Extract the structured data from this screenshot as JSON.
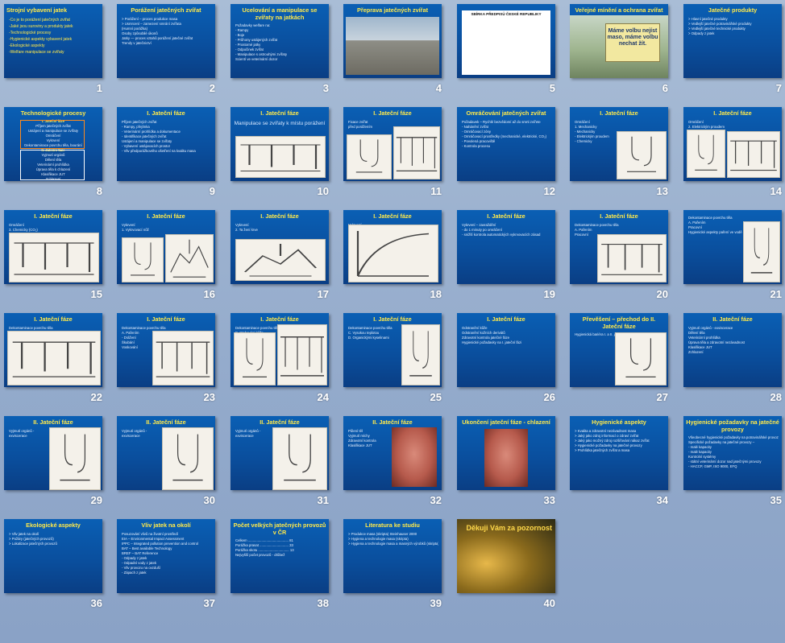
{
  "window": {
    "view": "slide-sorter"
  },
  "slides": [
    {
      "n": "1",
      "title": "Strojní vybavení jatek",
      "lines": [
        "-Co je to porážení jatečných zvířat",
        "-Jaké jsou suroviny a produkty jatek",
        "-Technologické procesy",
        "-Hygienické aspekty vybavení jatek",
        "-Ekologické aspekty",
        "-Welfare manipulace se zvířaty"
      ]
    },
    {
      "n": "2",
      "title": "Porážení jatečných  zvířat",
      "lines": [
        "> Porážení – proces produkce masa",
        "> Usmrcení – zamezení smrání zvířata",
        "(Humní porážka)",
        "",
        "Osoby způsobilé  úkonů",
        "Jatky — proces vztahů porážení jatečné zvířat",
        "Trendy v jatečnictví"
      ]
    },
    {
      "n": "3",
      "title": "Ucelování a manipulace se zvířaty na jatkách",
      "lines": [
        "Požadavky welfare na:",
        "- Rampy",
        "- Boje",
        "- Průhony ustájených zvířat",
        "- Prostorné jatky",
        "- Odpočinek zvířat",
        "- Manipulace s ostrouhými zvířaty",
        "",
        "Scientí ve veterinární dozor"
      ]
    },
    {
      "n": "4",
      "title": "Přeprava jatečných  zvířat",
      "lines": [
        "Požadavky welfare a"
      ]
    },
    {
      "n": "5",
      "title": "SBÍRKA PŘEDPISŮ ČESKÉ REPUBLIKY",
      "lines": []
    },
    {
      "n": "6",
      "title": "Veřejné mínění a ochrana zvířat",
      "lines": [],
      "billboard": "Máme volbu nejíst maso, máme volbu nechat žít."
    },
    {
      "n": "7",
      "title": "Jatečné produkty",
      "lines": [
        "> Hlavní jatečné produkty",
        "> Vedlejší jatečné potravinářské produkty",
        "> Vedlejší jatečné technické produkty",
        "> Odpady z jatek"
      ]
    },
    {
      "n": "8",
      "title": "Technologické  procesy",
      "lines": [
        "I. Jateční fáze",
        "Příjem jatečných zvířat",
        "Ustájení a manipulace se zvířaty",
        "Omráčení",
        "Vykrvení",
        "Dekontaminace povrchu těla, bourání",
        "II. Jateční fáze",
        "Vyjmutí orgánů",
        "Dělení těla",
        "Veterinární prohlídka",
        "Úprava těla k chlazení",
        "Klasifikace JUT",
        "Zchlazení"
      ]
    },
    {
      "n": "9",
      "title": "I. Jateční fáze",
      "lines": [
        "Příjem jatečných zvířat",
        "- Rampy, přejímka",
        "- Veterinární prohlídka a dokumentace",
        "- Identifikace jatečných zvířat",
        "Ustájení a manipulace se zvířaty",
        "- Vybavení ustájovacích prostor",
        "- Vliv předporážkového ošetření na kvalitu masa"
      ]
    },
    {
      "n": "10",
      "title": "I. Jateční fáze",
      "sub": "Manipulace se zvířaty k místu porážení",
      "lines": []
    },
    {
      "n": "11",
      "title": "I. Jateční fáze",
      "lines": [
        "Fixace zvířat",
        "před porážením"
      ]
    },
    {
      "n": "12",
      "title": "Omráčování jatečných  zvířat",
      "lines": [
        "Požadavek – Rychlé bezvědomí až do smrti zvířete",
        "- Nahánění zvířat",
        "- Omráčovací zóny",
        "- Omráčovací prostředky (mechanické, elektrické, CO₂)",
        "- Povolená pracoviště",
        "- Kontrola procesu"
      ]
    },
    {
      "n": "13",
      "title": "I. Jateční fáze",
      "lines": [
        "Omráčení",
        "1. Mechanicky",
        "- Mechanicky",
        "- Elektrickým proudem",
        "- Chemicky"
      ]
    },
    {
      "n": "14",
      "title": "I. Jateční fáze",
      "lines": [
        "Omráčení",
        "2. Elektrickým proudem"
      ]
    },
    {
      "n": "15",
      "title": "I. Jateční fáze",
      "lines": [
        "Omráčení",
        "3. Chemicky (CO₂)"
      ]
    },
    {
      "n": "16",
      "title": "I. Jateční fáze",
      "lines": [
        "Vykrvení",
        "1. Vykrvovací nůž"
      ]
    },
    {
      "n": "17",
      "title": "I. Jateční fáze",
      "lines": [
        "Vykrvení",
        "2. Ta žení krve"
      ]
    },
    {
      "n": "18",
      "title": "I. Jateční fáze",
      "lines": [
        "Vykrvení",
        "2. Tažení krve"
      ]
    },
    {
      "n": "19",
      "title": "I. Jateční fáze",
      "lines": [
        "Vykrvení – zavraždění",
        "- do 1 minuty po omráčení",
        "- snižší kontrola automatických vykrvovacích zásad"
      ]
    },
    {
      "n": "20",
      "title": "I. Jateční fáze",
      "lines": [
        "Dekontaminace povrchu těla",
        "A. Pařením",
        "Pracovní"
      ]
    },
    {
      "n": "21",
      "title": "",
      "lines": [
        "Dekontaminace povrchu těla",
        "A. Pařením",
        "Pracovní",
        "Hygienické aspekty paření ve vodě"
      ]
    },
    {
      "n": "22",
      "title": "I. Jateční fáze",
      "lines": [
        "Dekontaminace povrchu těla",
        "A. Pařením",
        "- Drážení"
      ]
    },
    {
      "n": "23",
      "title": "I. Jateční fáze",
      "lines": [
        "Dekontaminace povrchu těla",
        "A. Pařením",
        "- Drážení",
        "Škubání",
        "Voskování"
      ]
    },
    {
      "n": "24",
      "title": "I. Jateční fáze",
      "lines": [
        "Dekontaminace povrchu těla",
        "B. Stahování kůže"
      ]
    },
    {
      "n": "25",
      "title": "I. Jateční fáze",
      "lines": [
        "Dekontaminace povrchu těla",
        "C. Vysokou teplotou",
        "D. Organickými kyselinami"
      ]
    },
    {
      "n": "26",
      "title": "I. Jateční fáze",
      "lines": [
        "Odstranění kůže",
        "Odstranění kožních derivátů",
        "Zdravotní kontrola jatečné fáze",
        "Hygienické požadavky na I. jateční fázi"
      ]
    },
    {
      "n": "27",
      "title": "Převěšení – přechod do II. Jateční fáze",
      "lines": [
        "Hygienická bariéra I. a II. jateční fáze"
      ]
    },
    {
      "n": "28",
      "title": "II. Jateční fáze",
      "lines": [
        "Vyjmutí orgánů - exviscerace",
        "Dělení těla",
        "Veterinární prohlídka",
        "Úprava těla a zdravotní nezávadnost",
        "Klasifikace JUT",
        "Zchlazení"
      ]
    },
    {
      "n": "29",
      "title": "II. Jateční fáze",
      "lines": [
        "Vyjmutí orgánů -",
        "exviscerace"
      ]
    },
    {
      "n": "30",
      "title": "II. Jateční fáze",
      "lines": [
        "Vyjmutí orgánů -",
        "exviscerace"
      ]
    },
    {
      "n": "31",
      "title": "II. Jateční fáze",
      "lines": [
        "Vyjmutí orgánů -",
        "exviscerace"
      ]
    },
    {
      "n": "32",
      "title": "II. Jateční fáze",
      "lines": [
        "Půlení těl",
        "Vyjmutí míchy",
        "Zdravotní kontrola",
        "Klasifikace JUT"
      ]
    },
    {
      "n": "33",
      "title": "Ukončení jateční fáze - chlazení",
      "lines": []
    },
    {
      "n": "34",
      "title": "Hygienické aspekty",
      "lines": [
        "> Kvalita a zdravotní nezávadnost masa",
        "> Jaký jako zdroj informací o zdraví zvířat",
        "> Jaký jako možný zdroj rozšiřování nákaz zvířat",
        "> Hygienické požadavky na jatečné provozy",
        "> Prohlídka jatečných zvířat a masa"
      ]
    },
    {
      "n": "35",
      "title": "Hygienické požadavky na jatečné provozy",
      "lines": [
        "Všeobecné hygienické požadavky na potravinářské provozy",
        "Specifické požadavky na jatečné provozy –",
        "- malé kapacity",
        "- malé kapacity",
        "Kontrolní systémy",
        "- státní veterinární dozor nad jatečnými provozy",
        "- HACCP, GMP, ISO 9000, EFQ"
      ]
    },
    {
      "n": "36",
      "title": "Ekologické aspekty",
      "lines": [
        "> Vliv jatek na okolí",
        "> Požáry (jatečných provozů)",
        "> Lokalizace jatečných provozů"
      ]
    },
    {
      "n": "37",
      "title": "Vliv jatek na okolí",
      "lines": [
        "Posuzování vlivů na životní prostředí",
        "EIA – Environmental Impact Assessment",
        "IPPC – Integrated pollution prevention and control",
        "BAT – Best available Technology",
        "BREF – BAT Reference",
        "- Odpady z jatek",
        "- Odpadní vody z jatek",
        "- Vliv provozu na ovzduší",
        "- Zápach z jatek"
      ]
    },
    {
      "n": "38",
      "title": "Počet velkých jatečných provozů v ČR",
      "lines": [
        "Celkem .......................................... 81",
        "Porážka prasat .............................. 33",
        "Porážka skotu ................................ 13",
        "Nejvyšší počet provozů - drůbež"
      ]
    },
    {
      "n": "39",
      "title": "Literatura ke studiu",
      "lines": [
        "> Produkce masa (skripta)  Steinhauser  2000",
        "> Hygiena a technologie masa (skripta)",
        "> Hygiena a technologie masa a masných výrobků (skripta)  Steinhauser  1995"
      ]
    },
    {
      "n": "40",
      "title": "Děkuji Vám za pozornost",
      "lines": []
    }
  ]
}
